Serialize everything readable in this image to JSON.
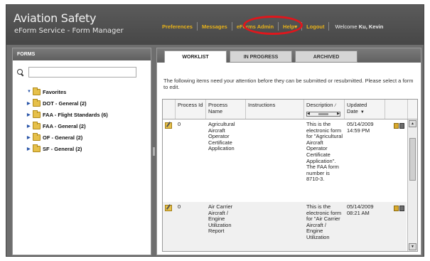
{
  "app": {
    "title": "Aviation Safety",
    "subtitle": "eForm Service - Form Manager"
  },
  "topnav": {
    "items": [
      "Preferences",
      "Messages",
      "eForms Admin",
      "Help",
      "Logout"
    ],
    "help_suffix": "▾",
    "welcome_prefix": "Welcome ",
    "user": "Ku, Kevin",
    "highlight_color": "#e0161c",
    "link_color": "#e8b21a"
  },
  "forms_panel": {
    "header": "FORMS",
    "search_placeholder": "",
    "tree": [
      {
        "label": "Favorites",
        "expanded": true
      },
      {
        "label": "DOT - General (2)",
        "expanded": false
      },
      {
        "label": "FAA - Flight Standards (6)",
        "expanded": false
      },
      {
        "label": "FAA - General (2)",
        "expanded": false
      },
      {
        "label": "OF - General (2)",
        "expanded": false
      },
      {
        "label": "SF - General (2)",
        "expanded": false
      }
    ]
  },
  "tabs": [
    "WORKLIST",
    "IN PROGRESS",
    "ARCHIVED"
  ],
  "active_tab": "WORKLIST",
  "worklist": {
    "instruction": "The following items need your attention before they can be submitted or resubmitted. Please select a form to edit.",
    "columns": [
      "Process Id",
      "Process Name",
      "Instructions",
      "Description",
      "Updated Date"
    ],
    "rows": [
      {
        "process_id": "0",
        "process_name": "Agricultural Aircraft Operator Certificate Application",
        "instructions": "",
        "description": "This is the electronic form for \"Agricultural Aircraft Operator Certificate Application\". The FAA form number is 8710-3.",
        "updated_date": "05/14/2009 14:59 PM"
      },
      {
        "process_id": "0",
        "process_name": "Air Carrier Aircraft / Engine Utilization Report",
        "instructions": "",
        "description": "This is the electronic form for \"Air Carrier Aircraft / Engine Utilization",
        "updated_date": "05/14/2009 08:21 AM"
      }
    ]
  }
}
